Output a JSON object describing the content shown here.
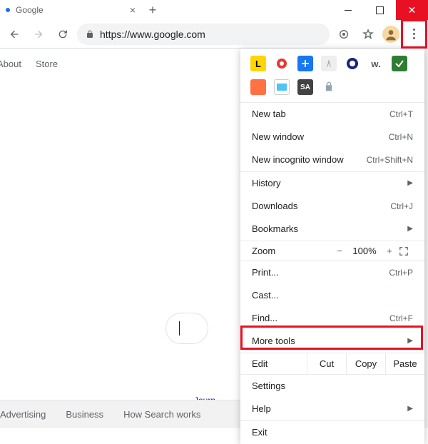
{
  "titlebar": {
    "tab_title": "Google",
    "close_tab": "×",
    "new_tab": "+",
    "winclose": "✕"
  },
  "toolbar": {
    "url": "https://www.google.com"
  },
  "page": {
    "nav": {
      "about": "About",
      "store": "Store"
    },
    "link": "Journ",
    "footer": {
      "adv": "Advertising",
      "biz": "Business",
      "how": "How Search works"
    }
  },
  "menu": {
    "new_tab": {
      "label": "New tab",
      "shortcut": "Ctrl+T"
    },
    "new_window": {
      "label": "New window",
      "shortcut": "Ctrl+N"
    },
    "new_incognito": {
      "label": "New incognito window",
      "shortcut": "Ctrl+Shift+N"
    },
    "history": {
      "label": "History"
    },
    "downloads": {
      "label": "Downloads",
      "shortcut": "Ctrl+J"
    },
    "bookmarks": {
      "label": "Bookmarks"
    },
    "zoom": {
      "label": "Zoom",
      "minus": "−",
      "value": "100%",
      "plus": "+"
    },
    "print": {
      "label": "Print...",
      "shortcut": "Ctrl+P"
    },
    "cast": {
      "label": "Cast..."
    },
    "find": {
      "label": "Find...",
      "shortcut": "Ctrl+F"
    },
    "more_tools": {
      "label": "More tools"
    },
    "edit": {
      "label": "Edit",
      "cut": "Cut",
      "copy": "Copy",
      "paste": "Paste"
    },
    "settings": {
      "label": "Settings"
    },
    "help": {
      "label": "Help"
    },
    "exit": {
      "label": "Exit"
    }
  },
  "ext_labels": {
    "l": "L",
    "sa": "SA",
    "w": "w."
  }
}
